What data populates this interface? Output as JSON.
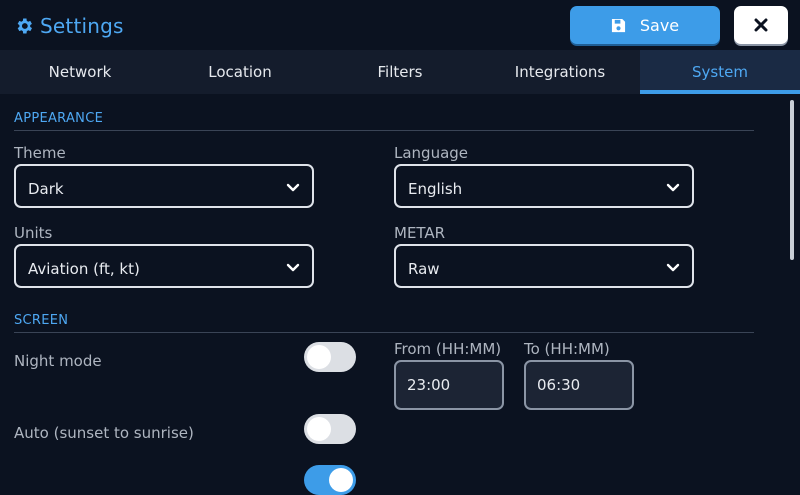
{
  "header": {
    "title": "Settings",
    "save_label": "Save"
  },
  "tabs": [
    {
      "label": "Network",
      "active": false
    },
    {
      "label": "Location",
      "active": false
    },
    {
      "label": "Filters",
      "active": false
    },
    {
      "label": "Integrations",
      "active": false
    },
    {
      "label": "System",
      "active": true
    }
  ],
  "appearance": {
    "section_title": "APPEARANCE",
    "theme": {
      "label": "Theme",
      "value": "Dark"
    },
    "language": {
      "label": "Language",
      "value": "English"
    },
    "units": {
      "label": "Units",
      "value": "Aviation (ft, kt)"
    },
    "metar": {
      "label": "METAR",
      "value": "Raw"
    }
  },
  "screen": {
    "section_title": "SCREEN",
    "night_mode": {
      "label": "Night mode",
      "on": false
    },
    "auto": {
      "label": "Auto (sunset to sunrise)",
      "on": false
    },
    "third_toggle": {
      "on": true
    },
    "from": {
      "label": "From (HH:MM)",
      "value": "23:00"
    },
    "to": {
      "label": "To (HH:MM)",
      "value": "06:30"
    }
  },
  "colors": {
    "accent": "#3d9ce8",
    "background": "#0b1220",
    "tab_bar": "#141c2c"
  },
  "icons": {
    "title": "gear-icon",
    "save": "floppy-disk-icon",
    "close": "close-icon",
    "select": "chevron-down-icon"
  }
}
